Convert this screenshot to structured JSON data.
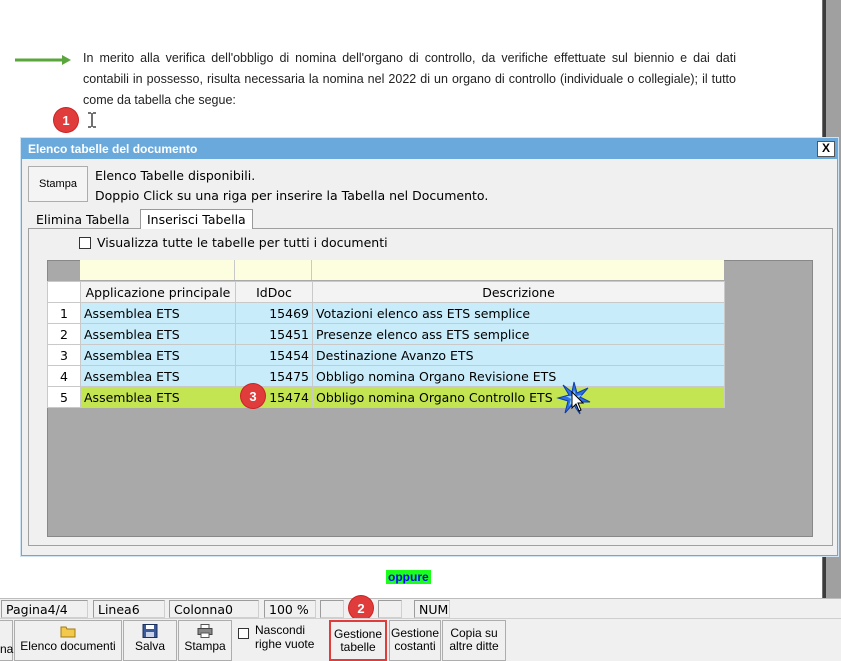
{
  "document": {
    "paragraph": "In merito alla verifica dell'obbligo di nomina dell'organo di controllo, da verifiche effettuate sul biennio e dai dati contabili in possesso, risulta necessaria la nomina nel 2022 di un organo di controllo (individuale o collegiale); il tutto come da tabella che segue:",
    "oppure": "oppure"
  },
  "badges": {
    "b1": "1",
    "b2": "2",
    "b3": "3"
  },
  "dialog": {
    "title": "Elenco tabelle del documento",
    "close": "X",
    "stampa": "Stampa",
    "info_line1": "Elenco Tabelle disponibili.",
    "info_line2": "Doppio Click su una riga per inserire la Tabella nel Documento.",
    "tabs": [
      {
        "label": "Elimina Tabella",
        "active": false
      },
      {
        "label": "Inserisci Tabella",
        "active": true
      }
    ],
    "checkbox_label": "Visualizza tutte le tabelle per tutti i documenti",
    "columns": [
      "Applicazione principale",
      "IdDoc",
      "Descrizione"
    ],
    "rows": [
      {
        "n": "1",
        "app": "Assemblea ETS",
        "id": "15469",
        "desc": "Votazioni elenco ass ETS semplice"
      },
      {
        "n": "2",
        "app": "Assemblea ETS",
        "id": "15451",
        "desc": "Presenze elenco ass ETS semplice"
      },
      {
        "n": "3",
        "app": "Assemblea ETS",
        "id": "15454",
        "desc": "Destinazione Avanzo ETS"
      },
      {
        "n": "4",
        "app": "Assemblea ETS",
        "id": "15475",
        "desc": "Obbligo nomina Organo Revisione ETS"
      },
      {
        "n": "5",
        "app": "Assemblea ETS",
        "id": "15474",
        "desc": "Obbligo nomina Organo Controllo ETS"
      }
    ],
    "selected_row": "5"
  },
  "statusbar": {
    "pagina": "Pagina4/4",
    "linea": "Linea6",
    "colonna": "Colonna0",
    "zoom": "100 %",
    "num": "NUM"
  },
  "toolbar": {
    "cut_label": "na",
    "elenco_documenti": "Elenco documenti",
    "salva": "Salva",
    "stampa": "Stampa",
    "nascondi_l1": "Nascondi",
    "nascondi_l2": "righe vuote",
    "gestione_tabelle_l1": "Gestione",
    "gestione_tabelle_l2": "tabelle",
    "gestione_costanti_l1": "Gestione",
    "gestione_costanti_l2": "costanti",
    "copia_l1": "Copia su",
    "copia_l2": "altre ditte"
  },
  "colors": {
    "title_bar": "#6aa9dc",
    "row_bg": "#c8ecfa",
    "selected_row_bg": "#c4e552",
    "badge": "#e03c3c",
    "arrow": "#5aa63c",
    "oppure_bg": "#1aff1a",
    "oppure_text": "#0000ff"
  }
}
